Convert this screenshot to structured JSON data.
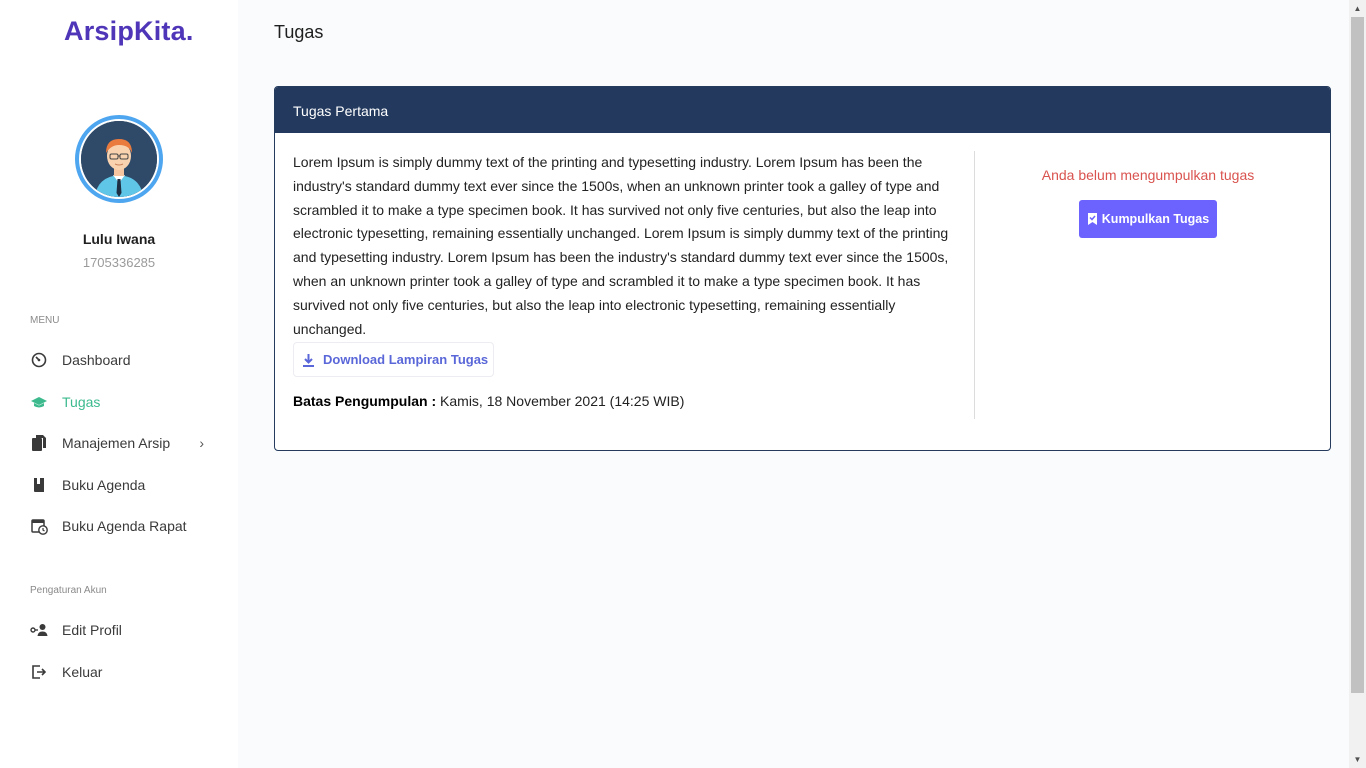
{
  "app": {
    "logo": "ArsipKita."
  },
  "user": {
    "name": "Lulu Iwana",
    "id": "1705336285"
  },
  "sidebar": {
    "menu_label": "MENU",
    "items": [
      {
        "label": "Dashboard",
        "icon": "dashboard-icon"
      },
      {
        "label": "Tugas",
        "icon": "graduation-cap-icon",
        "active": true
      },
      {
        "label": "Manajemen Arsip",
        "icon": "document-copy-icon",
        "has_submenu": true
      },
      {
        "label": "Buku Agenda",
        "icon": "book-icon"
      },
      {
        "label": "Buku Agenda Rapat",
        "icon": "calendar-clock-icon"
      }
    ],
    "account_label": "Pengaturan Akun",
    "account_items": [
      {
        "label": "Edit Profil",
        "icon": "user-key-icon"
      },
      {
        "label": "Keluar",
        "icon": "logout-icon"
      }
    ],
    "chevron": "›"
  },
  "page": {
    "title": "Tugas"
  },
  "task": {
    "title": "Tugas Pertama",
    "description": "Lorem Ipsum is simply dummy text of the printing and typesetting industry. Lorem Ipsum has been the industry's standard dummy text ever since the 1500s, when an unknown printer took a galley of type and scrambled it to make a type specimen book. It has survived not only five centuries, but also the leap into electronic typesetting, remaining essentially unchanged. Lorem Ipsum is simply dummy text of the printing and typesetting industry. Lorem Ipsum has been the industry's standard dummy text ever since the 1500s, when an unknown printer took a galley of type and scrambled it to make a type specimen book. It has survived not only five centuries, but also the leap into electronic typesetting, remaining essentially unchanged.",
    "download_label": "Download Lampiran Tugas",
    "deadline_label": "Batas Pengumpulan :",
    "deadline_value": "Kamis, 18 November 2021 (14:25 WIB)",
    "status_text": "Anda belum mengumpulkan tugas",
    "submit_label": "Kumpulkan Tugas"
  },
  "colors": {
    "brand": "#4f35b8",
    "active_nav": "#3cba8e",
    "card_header": "#233a5e",
    "status_warning": "#d9534f",
    "submit_button": "#6c63ff",
    "download_link": "#5a67d8"
  }
}
